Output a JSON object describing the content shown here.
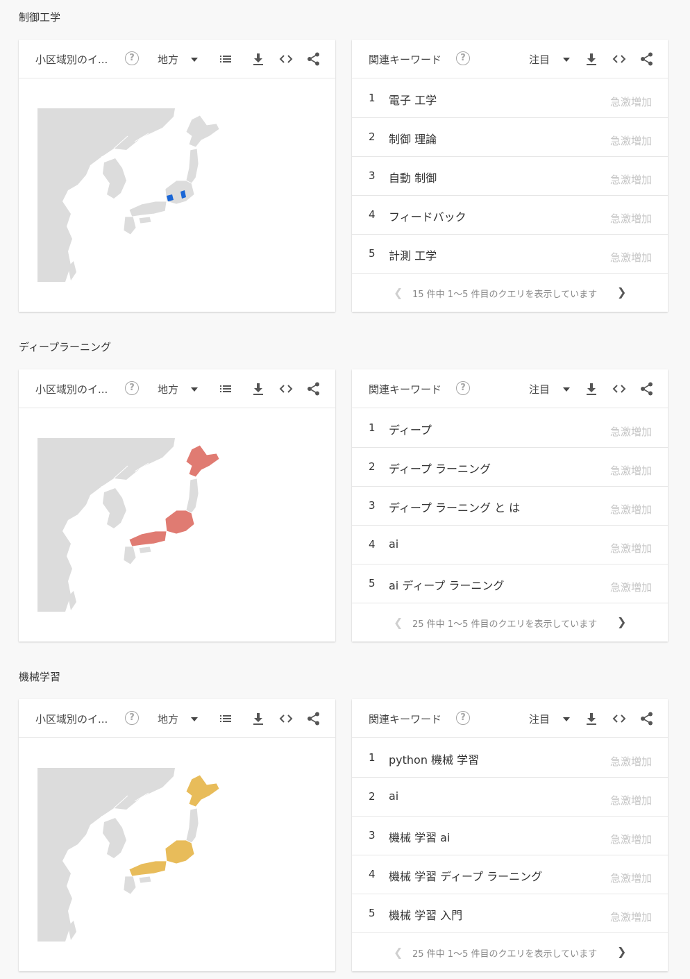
{
  "sections": [
    {
      "title": "制御工学",
      "region": {
        "title": "小区域別のイ...",
        "dropdown": "地方",
        "highlight_color": "#1a66d6"
      },
      "related": {
        "title": "関連キーワード",
        "dropdown": "注目",
        "rows": [
          {
            "rank": "1",
            "query": "電子 工学",
            "badge": "急激増加"
          },
          {
            "rank": "2",
            "query": "制御 理論",
            "badge": "急激増加"
          },
          {
            "rank": "3",
            "query": "自動 制御",
            "badge": "急激増加"
          },
          {
            "rank": "4",
            "query": "フィードバック",
            "badge": "急激増加"
          },
          {
            "rank": "5",
            "query": "計測 工学",
            "badge": "急激増加"
          }
        ],
        "pager": "15 件中 1～5 件目のクエリを表示しています"
      }
    },
    {
      "title": "ディープラーニング",
      "region": {
        "title": "小区域別のイ...",
        "dropdown": "地方",
        "highlight_color": "#e07b72"
      },
      "related": {
        "title": "関連キーワード",
        "dropdown": "注目",
        "rows": [
          {
            "rank": "1",
            "query": "ディープ",
            "badge": "急激増加"
          },
          {
            "rank": "2",
            "query": "ディープ ラーニング",
            "badge": "急激増加"
          },
          {
            "rank": "3",
            "query": "ディープ ラーニング と は",
            "badge": "急激増加"
          },
          {
            "rank": "4",
            "query": "ai",
            "badge": "急激増加"
          },
          {
            "rank": "5",
            "query": "ai ディープ ラーニング",
            "badge": "急激増加"
          }
        ],
        "pager": "25 件中 1～5 件目のクエリを表示しています"
      }
    },
    {
      "title": "機械学習",
      "region": {
        "title": "小区域別のイ...",
        "dropdown": "地方",
        "highlight_color": "#e8bc5a"
      },
      "related": {
        "title": "関連キーワード",
        "dropdown": "注目",
        "rows": [
          {
            "rank": "1",
            "query": "python 機械 学習",
            "badge": "急激増加"
          },
          {
            "rank": "2",
            "query": "ai",
            "badge": "急激増加"
          },
          {
            "rank": "3",
            "query": "機械 学習 ai",
            "badge": "急激増加"
          },
          {
            "rank": "4",
            "query": "機械 学習 ディープ ラーニング",
            "badge": "急激増加"
          },
          {
            "rank": "5",
            "query": "機械 学習 入門",
            "badge": "急激増加"
          }
        ],
        "pager": "25 件中 1～5 件目のクエリを表示しています"
      }
    }
  ],
  "colors": {
    "land": "#dcdcdc",
    "japan_base": "#dcdcdc"
  },
  "icons": [
    "help-icon",
    "list-icon",
    "download-icon",
    "embed-icon",
    "share-icon",
    "dropdown-arrow-icon",
    "chevron-left-icon",
    "chevron-right-icon"
  ]
}
